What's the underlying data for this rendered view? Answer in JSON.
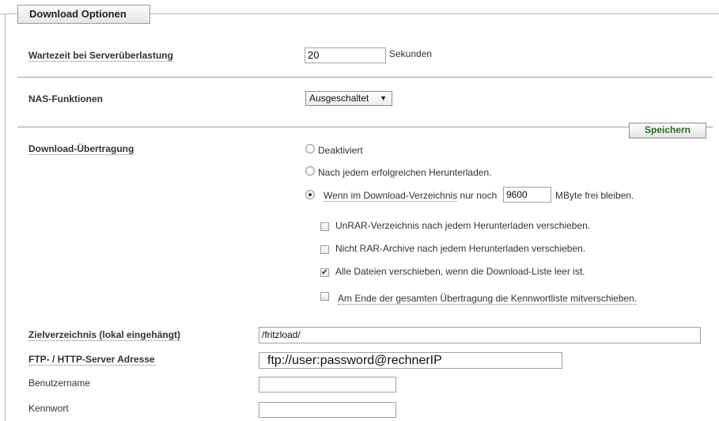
{
  "section": {
    "title": "Download Optionen"
  },
  "wait": {
    "label": "Wartezeit bei Serverüberlastung",
    "value": "20",
    "unit": "Sekunden"
  },
  "nas": {
    "label": "NAS-Funktionen",
    "selected": "Ausgeschaltet"
  },
  "save_button": "Speichern",
  "transfer": {
    "label": "Download-Übertragung",
    "options": [
      {
        "label": "Deaktiviert",
        "checked": false
      },
      {
        "label": "Nach jedem erfolgreichen Herunterladen.",
        "checked": false
      },
      {
        "label_before": "Wenn im Download-Verzeichnis",
        "label_mid": " nur noch ",
        "value": "9600",
        "label_after": "MByte frei bleiben.",
        "checked": true
      }
    ],
    "checkboxes": [
      {
        "label": "UnRAR-Verzeichnis nach jedem Herunterladen verschieben.",
        "checked": false
      },
      {
        "label": "Nicht RAR-Archive nach jedem Herunterladen verschieben.",
        "checked": false
      },
      {
        "label": "Alle Dateien verschieben, wenn die Download-Liste leer ist.",
        "checked": true
      },
      {
        "label": "Am Ende der gesamten Übertragung die Kennwortliste mitverschieben.",
        "checked": false
      }
    ]
  },
  "target": {
    "label": "Zielverzeichnis (lokal eingehängt)",
    "value": "/fritzload/"
  },
  "server": {
    "label": "FTP- / HTTP-Server Adresse",
    "value": "ftp://user:password@rechnerIP"
  },
  "username": {
    "label": "Benutzername",
    "value": ""
  },
  "password": {
    "label": "Kennwort",
    "value": ""
  }
}
